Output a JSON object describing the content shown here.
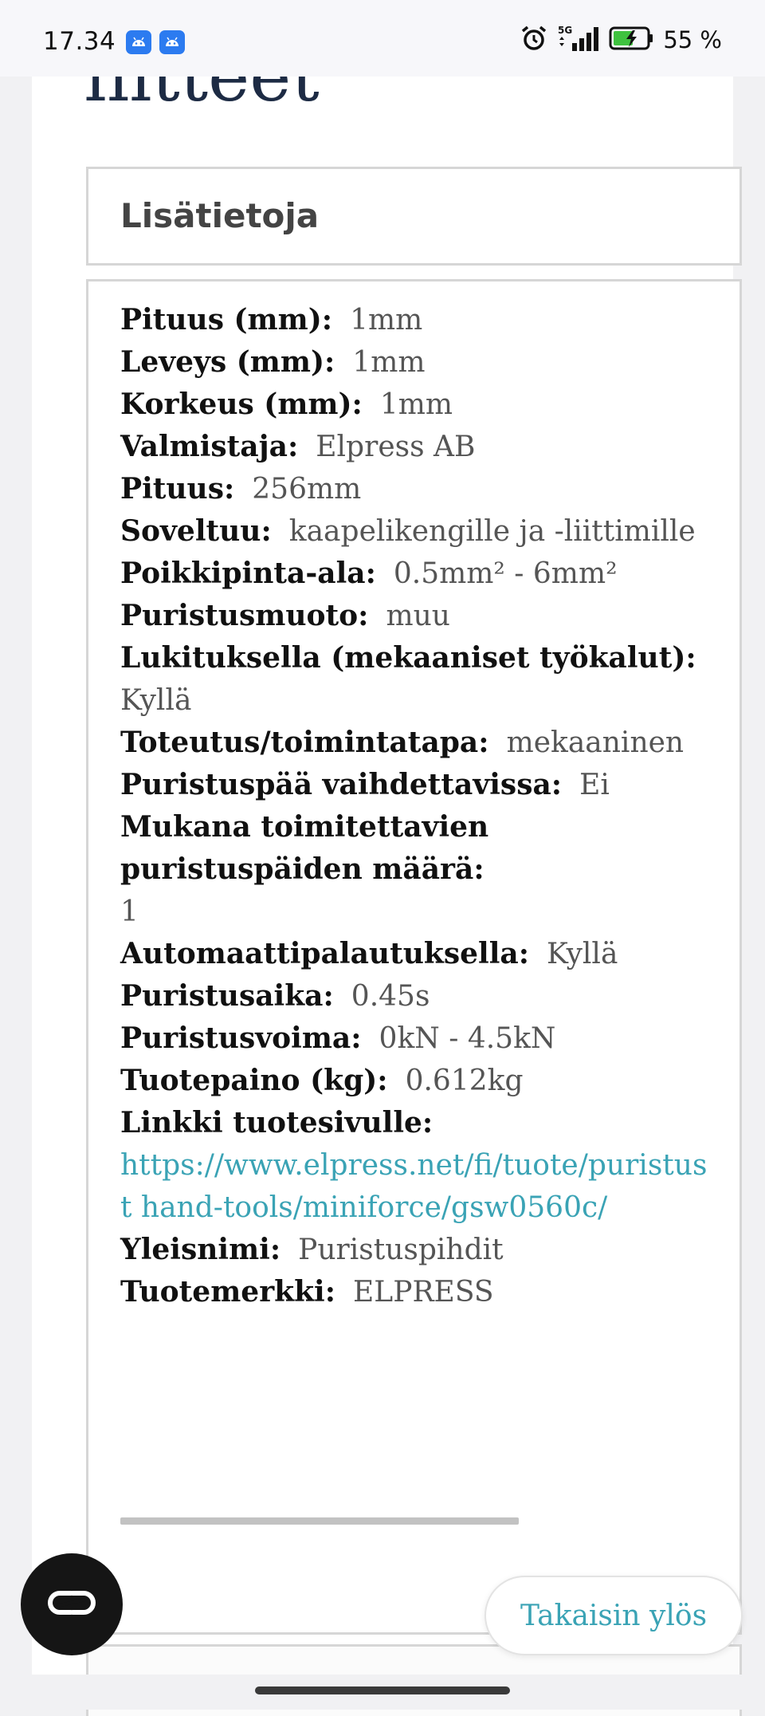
{
  "status_bar": {
    "time": "17.34",
    "battery": "55 %",
    "network": "5G"
  },
  "page": {
    "heading": "liitteet"
  },
  "section": {
    "title": "Lisätietoja"
  },
  "properties": [
    {
      "label": "Pituus (mm):",
      "value": "1mm"
    },
    {
      "label": "Leveys (mm):",
      "value": "1mm"
    },
    {
      "label": "Korkeus (mm):",
      "value": "1mm"
    },
    {
      "label": "Valmistaja:",
      "value": "Elpress AB"
    },
    {
      "label": "Pituus:",
      "value": "256mm"
    },
    {
      "label": "Soveltuu:",
      "value": "kaapelikengille ja -liittimille"
    },
    {
      "label": "Poikkipinta-ala:",
      "value": "0.5mm² - 6mm²"
    },
    {
      "label": "Puristusmuoto:",
      "value": "muu"
    },
    {
      "label": "Lukituksella (mekaaniset työkalut):",
      "value": "Kyllä"
    },
    {
      "label": "Toteutus/toimintatapa:",
      "value": "mekaaninen"
    },
    {
      "label": "Puristuspää vaihdettavissa:",
      "value": "Ei"
    },
    {
      "label": "Mukana toimitettavien puristuspäiden määrä:",
      "value": "1"
    },
    {
      "label": "Automaattipalautuksella:",
      "value": "Kyllä"
    },
    {
      "label": "Puristusaika:",
      "value": "0.45s"
    },
    {
      "label": "Puristusvoima:",
      "value": "0kN - 4.5kN"
    },
    {
      "label": "Tuotepaino (kg):",
      "value": "0.612kg"
    },
    {
      "label": "Linkki tuotesivulle:",
      "value": "https://www.elpress.net/fi/tuote/puristust hand-tools/miniforce/gsw0560c/"
    },
    {
      "label": "Yleisnimi:",
      "value": "Puristuspihdit"
    },
    {
      "label": "Tuotemerkki:",
      "value": "ELPRESS"
    }
  ],
  "back_to_top": {
    "label": "Takaisin ylös"
  },
  "icons": {
    "cookie": "cookie-settings-icon",
    "alarm": "alarm-icon",
    "signal": "signal-icon",
    "battery": "battery-charging-icon"
  }
}
